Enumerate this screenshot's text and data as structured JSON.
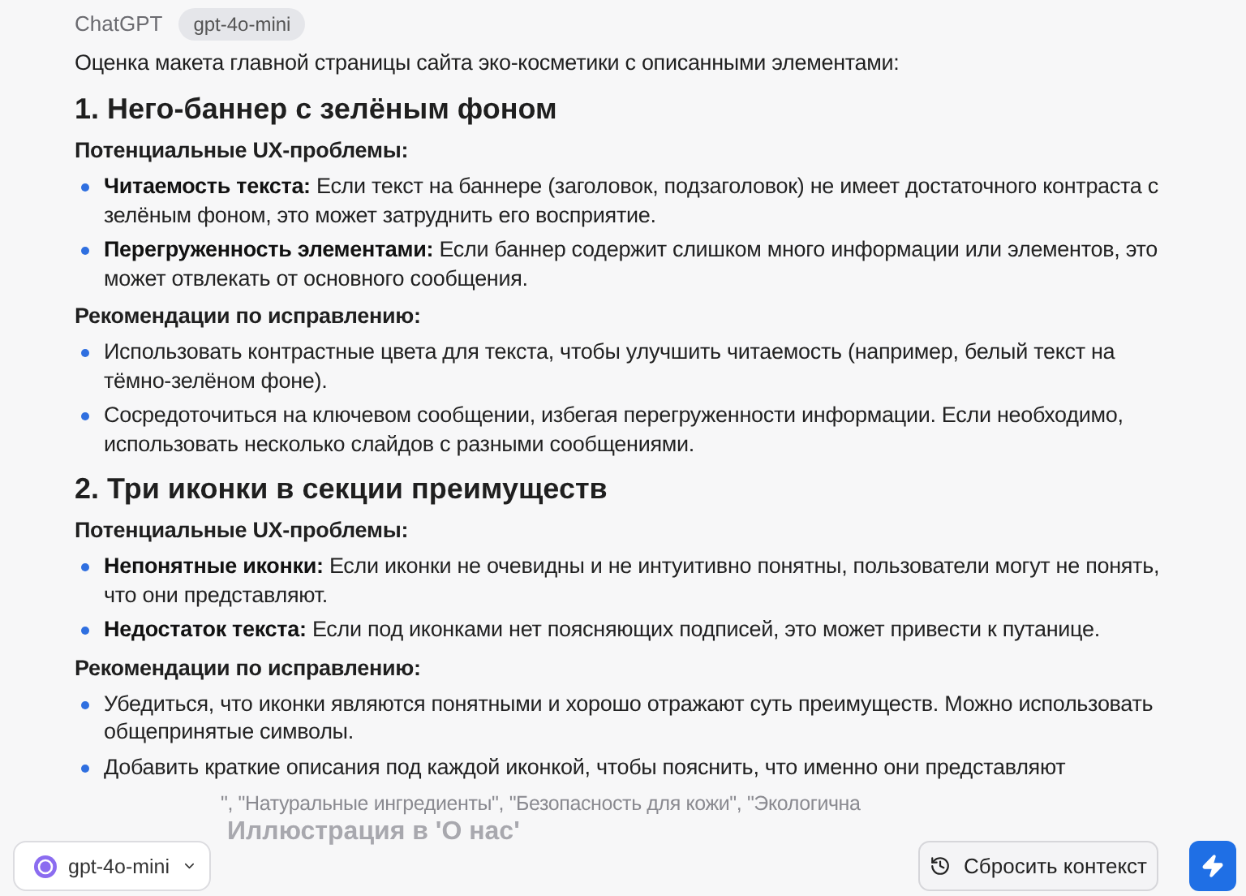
{
  "header": {
    "author": "ChatGPT",
    "model_badge": "gpt-4o-mini"
  },
  "intro": "Оценка макета главной страницы сайта эко-косметики с описанными элементами:",
  "sections": [
    {
      "heading": "1. Него-баннер с зелёным фоном",
      "blocks": [
        {
          "title": "Потенциальные UX-проблемы:",
          "items": [
            "**Читаемость текста:** Если текст на баннере (заголовок, подзаголовок) не имеет достаточного контраста с зелёным фоном, это может затруднить его восприятие.",
            "**Перегруженность элементами:** Если баннер содержит слишком много информации или элементов, это может отвлекать от основного сообщения."
          ]
        },
        {
          "title": "Рекомендации по исправлению:",
          "items": [
            "Использовать контрастные цвета для текста, чтобы улучшить читаемость (например, белый текст на тёмно-зелёном фоне).",
            "Сосредоточиться на ключевом сообщении, избегая перегруженности информации. Если необходимо, использовать несколько слайдов с разными сообщениями."
          ]
        }
      ]
    },
    {
      "heading": "2. Три иконки в секции преимуществ",
      "blocks": [
        {
          "title": "Потенциальные UX-проблемы:",
          "items": [
            "**Непонятные иконки:** Если иконки не очевидны и не интуитивно понятны, пользователи могут не понять, что они представляют.",
            "**Недостаток текста:** Если под иконками нет поясняющих подписей, это может привести к путанице."
          ]
        },
        {
          "title": "Рекомендации по исправлению:",
          "items": [
            "Убедиться, что иконки являются понятными и хорошо отражают суть преимуществ. Можно использовать общепринятые символы.",
            "Добавить краткие описания под каждой иконкой, чтобы пояснить, что именно они представляют"
          ]
        }
      ]
    }
  ],
  "covered_line": "\", \"Натуральные ингредиенты\", \"Безопасность для кожи\", \"Экологична",
  "next_heading": "Иллюстрация в 'О нас'",
  "composer": {
    "model": "gpt-4o-mini",
    "reset_label": "Сбросить контекст"
  }
}
